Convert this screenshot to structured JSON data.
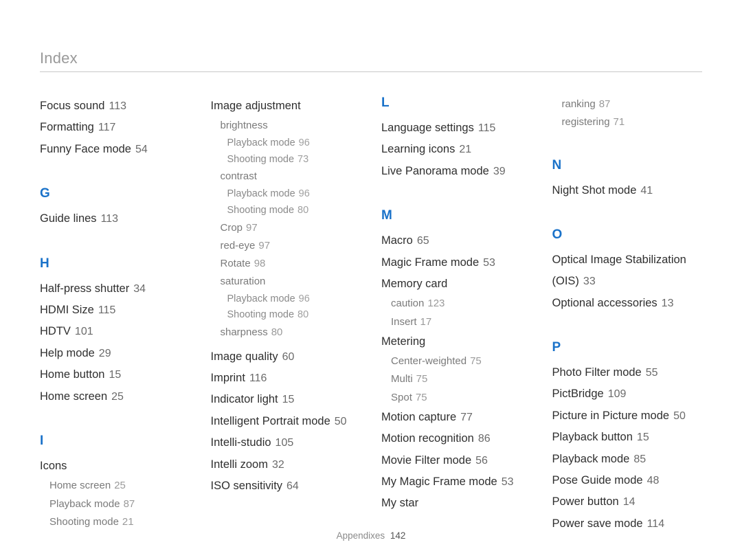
{
  "header": {
    "title": "Index"
  },
  "footer": {
    "label": "Appendixes",
    "page": "142"
  },
  "col1": {
    "pre": [
      {
        "t": "Focus sound",
        "p": "113"
      },
      {
        "t": "Formatting",
        "p": "117"
      },
      {
        "t": "Funny Face mode",
        "p": "54"
      }
    ],
    "g_letter": "G",
    "g": [
      {
        "t": "Guide lines",
        "p": "113"
      }
    ],
    "h_letter": "H",
    "h": [
      {
        "t": "Half-press shutter",
        "p": "34"
      },
      {
        "t": "HDMI Size",
        "p": "115"
      },
      {
        "t": "HDTV",
        "p": "101"
      },
      {
        "t": "Help mode",
        "p": "29"
      },
      {
        "t": "Home button",
        "p": "15"
      },
      {
        "t": "Home screen",
        "p": "25"
      }
    ],
    "i_letter": "I",
    "i_head": "Icons",
    "i_subs": [
      {
        "t": "Home screen",
        "p": "25"
      },
      {
        "t": "Playback mode",
        "p": "87"
      },
      {
        "t": "Shooting mode",
        "p": "21"
      }
    ]
  },
  "col2": {
    "ia_head": "Image adjustment",
    "ia_bri_head": "brightness",
    "ia_bri": [
      {
        "t": "Playback mode",
        "p": "96"
      },
      {
        "t": "Shooting mode",
        "p": "73"
      }
    ],
    "ia_con_head": "contrast",
    "ia_con": [
      {
        "t": "Playback mode",
        "p": "96"
      },
      {
        "t": "Shooting mode",
        "p": "80"
      }
    ],
    "ia_misc": [
      {
        "t": "Crop",
        "p": "97"
      },
      {
        "t": "red-eye",
        "p": "97"
      },
      {
        "t": "Rotate",
        "p": "98"
      }
    ],
    "ia_sat_head": "saturation",
    "ia_sat": [
      {
        "t": "Playback mode",
        "p": "96"
      },
      {
        "t": "Shooting mode",
        "p": "80"
      }
    ],
    "ia_last": {
      "t": "sharpness",
      "p": "80"
    },
    "rest": [
      {
        "t": "Image quality",
        "p": "60"
      },
      {
        "t": "Imprint",
        "p": "116"
      },
      {
        "t": "Indicator light",
        "p": "15"
      },
      {
        "t": "Intelligent Portrait mode",
        "p": "50"
      },
      {
        "t": "Intelli-studio",
        "p": "105"
      },
      {
        "t": "Intelli zoom",
        "p": "32"
      },
      {
        "t": "ISO sensitivity",
        "p": "64"
      }
    ]
  },
  "col3": {
    "l_letter": "L",
    "l": [
      {
        "t": "Language settings",
        "p": "115"
      },
      {
        "t": "Learning icons",
        "p": "21"
      },
      {
        "t": "Live Panorama mode",
        "p": "39"
      }
    ],
    "m_letter": "M",
    "m_pre": [
      {
        "t": "Macro",
        "p": "65"
      },
      {
        "t": "Magic Frame mode",
        "p": "53"
      }
    ],
    "mem_head": "Memory card",
    "mem": [
      {
        "t": "caution",
        "p": "123"
      },
      {
        "t": "Insert",
        "p": "17"
      }
    ],
    "met_head": "Metering",
    "met": [
      {
        "t": "Center-weighted",
        "p": "75"
      },
      {
        "t": "Multi",
        "p": "75"
      },
      {
        "t": "Spot",
        "p": "75"
      }
    ],
    "m_rest": [
      {
        "t": "Motion capture",
        "p": "77"
      },
      {
        "t": "Motion recognition",
        "p": "86"
      },
      {
        "t": "Movie Filter mode",
        "p": "56"
      },
      {
        "t": "My Magic Frame mode",
        "p": "53"
      },
      {
        "t": "My star",
        "p": ""
      }
    ]
  },
  "col4": {
    "pre": [
      {
        "t": "ranking",
        "p": "87"
      },
      {
        "t": "registering",
        "p": "71"
      }
    ],
    "n_letter": "N",
    "n": [
      {
        "t": "Night Shot mode",
        "p": "41"
      }
    ],
    "o_letter": "O",
    "o": [
      {
        "t": "Optical Image Stabilization (OIS)",
        "p": "33"
      },
      {
        "t": "Optional accessories",
        "p": "13"
      }
    ],
    "p_letter": "P",
    "p": [
      {
        "t": "Photo Filter mode",
        "p": "55"
      },
      {
        "t": "PictBridge",
        "p": "109"
      },
      {
        "t": "Picture in Picture mode",
        "p": "50"
      },
      {
        "t": "Playback button",
        "p": "15"
      },
      {
        "t": "Playback mode",
        "p": "85"
      },
      {
        "t": "Pose Guide mode",
        "p": "48"
      },
      {
        "t": "Power button",
        "p": "14"
      },
      {
        "t": "Power save mode",
        "p": "114"
      }
    ]
  }
}
